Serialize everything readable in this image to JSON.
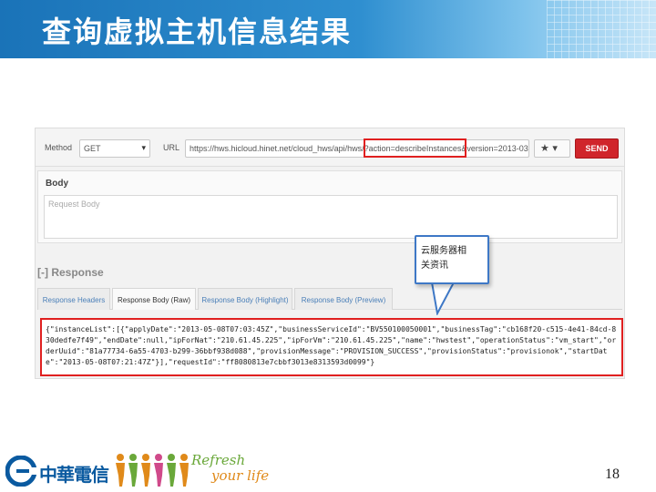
{
  "slide": {
    "title": "查询虚拟主机信息结果",
    "page_number": "18"
  },
  "toolbar": {
    "method_label": "Method",
    "method_value": "GET",
    "url_label": "URL",
    "url_value": "https://hws.hicloud.hinet.net/cloud_hws/api/hws/?action=describeInstances&version=2013-03-",
    "send_label": "SEND",
    "star_glyph": "★ ▾"
  },
  "request_body": {
    "heading": "Body",
    "placeholder": "Request Body"
  },
  "response": {
    "heading": "[-] Response",
    "tabs": [
      {
        "label": "Response Headers"
      },
      {
        "label": "Response Body (Raw)"
      },
      {
        "label": "Response Body (Highlight)"
      },
      {
        "label": "Response Body (Preview)"
      }
    ],
    "active_tab": "Response Body (Raw)",
    "body_text": "{\"instanceList\":[{\"applyDate\":\"2013-05-08T07:03:45Z\",\"businessServiceId\":\"BV550100050001\",\"businessTag\":\"cb168f20-c515-4e41-84cd-830dedfe7f49\",\"endDate\":null,\"ipForNat\":\"210.61.45.225\",\"ipForVm\":\"210.61.45.225\",\"name\":\"hwstest\",\"operationStatus\":\"vm_start\",\"orderUuid\":\"81a77734-6a55-4703-b299-36bbf938d088\",\"provisionMessage\":\"PROVISION_SUCCESS\",\"provisionStatus\":\"provisionok\",\"startDate\":\"2013-05-08T07:21:47Z\"}],\"requestId\":\"ff8080813e7cbbf3013e8313593d0099\"}"
  },
  "callout": {
    "line1": "云服务器相",
    "line2": "关资讯"
  },
  "footer": {
    "company_name": "中華電信",
    "slogan_line1": "Refresh",
    "slogan_line2": "your life"
  },
  "colors": {
    "banner_blue": "#1a73b8",
    "highlight_red": "#e02020",
    "send_red": "#d0252b",
    "callout_border": "#3e78c6"
  }
}
